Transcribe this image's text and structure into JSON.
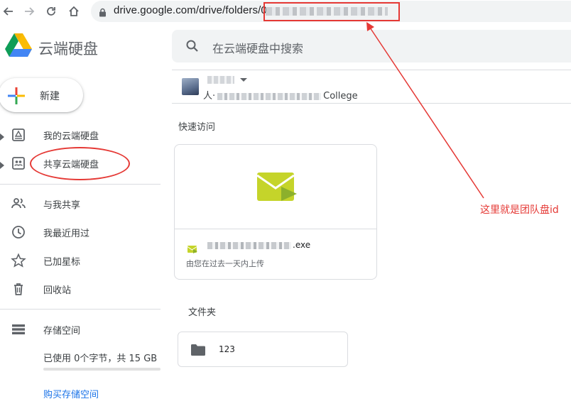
{
  "browser": {
    "back_icon": "arrow-left-icon",
    "forward_icon": "arrow-right-icon",
    "reload_icon": "reload-icon",
    "home_icon": "home-icon",
    "url": "drive.google.com/drive/folders/0"
  },
  "app": {
    "title": "云端硬盘"
  },
  "new_button": {
    "label": "新建"
  },
  "search": {
    "placeholder": "在云端硬盘中搜索"
  },
  "sidebar": {
    "items": [
      {
        "label": "我的云端硬盘",
        "icon": "my-drive-icon"
      },
      {
        "label": "共享云端硬盘",
        "icon": "shared-drives-icon"
      },
      {
        "label": "与我共享",
        "icon": "people-icon"
      },
      {
        "label": "我最近用过",
        "icon": "clock-icon"
      },
      {
        "label": "已加星标",
        "icon": "star-icon"
      },
      {
        "label": "回收站",
        "icon": "trash-icon"
      },
      {
        "label": "存储空间",
        "icon": "storage-icon"
      }
    ],
    "storage_used": "已使用 0个字节，共 15 GB",
    "storage_fraction": 0,
    "buy_storage": "购买存储空间"
  },
  "team": {
    "line2_prefix": "人·",
    "line2_suffix": "College"
  },
  "quick_access": {
    "title": "快速访问",
    "file_suffix": ".exe",
    "file_sub": "由您在过去一天内上传"
  },
  "folders": {
    "title": "文件夹",
    "items": [
      {
        "name": "123"
      }
    ]
  },
  "annotation": {
    "text": "这里就是团队盘id"
  },
  "colors": {
    "annotation": "#e53935",
    "link": "#1a73e8",
    "file_icon": "#c5d42a"
  }
}
